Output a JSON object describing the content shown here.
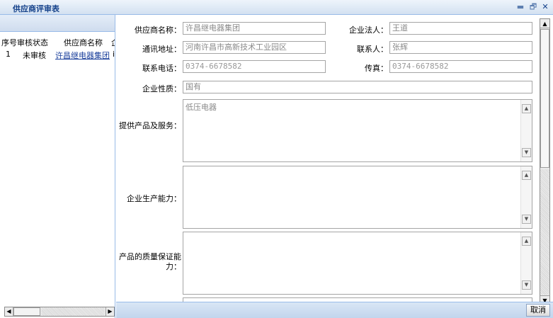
{
  "window": {
    "title": "供应商评审表",
    "minimize_glyph": "▬",
    "restore_glyph": "🗗",
    "close_glyph": "✕"
  },
  "grid": {
    "columns": [
      "序号",
      "审核状态",
      "供应商名称",
      "企"
    ],
    "rows": [
      {
        "index": "1",
        "status": "未审核",
        "name": "许昌继电器集团",
        "extra": "i"
      }
    ]
  },
  "form": {
    "supplier_name_label": "供应商名称：",
    "supplier_name_value": "许昌继电器集团",
    "legal_person_label": "企业法人：",
    "legal_person_value": "王道",
    "address_label": "通讯地址：",
    "address_value": "河南许昌市高新技术工业园区",
    "contact_label": "联系人：",
    "contact_value": "张辉",
    "phone_label": "联系电话：",
    "phone_value": "0374-6678582",
    "fax_label": "传真：",
    "fax_value": "0374-6678582",
    "nature_label": "企业性质：",
    "nature_value": "国有",
    "products_label": "提供产品及服务：",
    "products_value": "低压电器",
    "capacity_label": "企业生产能力：",
    "capacity_value": "",
    "quality_label": "产品的质量保证能力：",
    "quality_value": ""
  },
  "footer": {
    "cancel_label": "取消"
  }
}
